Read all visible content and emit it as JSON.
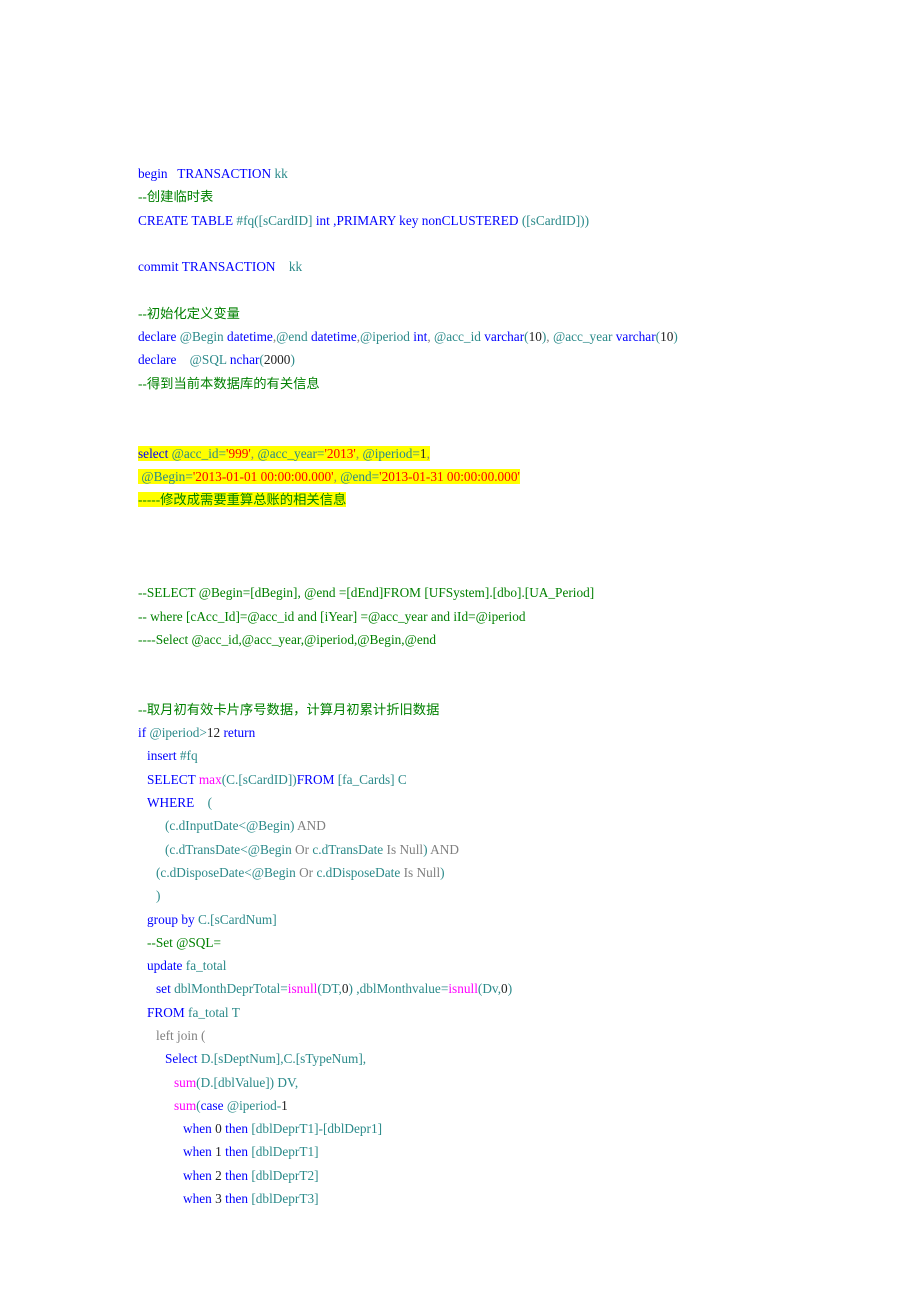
{
  "document": {
    "kind": "sql-script",
    "page_background": "#ffffff",
    "colors": {
      "keyword": "#0000ff",
      "comment": "#008000",
      "function": "#ff00ff",
      "identifier": "#2b8a8a",
      "operator": "#808080",
      "number": "#222222",
      "string": "#ff0000",
      "highlight": "#ffff00"
    }
  },
  "code": {
    "lines": [
      {
        "id": "line-1",
        "indent": 0,
        "highlight": false,
        "tokens": [
          {
            "t": "begin   ",
            "c": "kw"
          },
          {
            "t": "TRANSACTION ",
            "c": "kw"
          },
          {
            "t": "kk",
            "c": "id"
          }
        ]
      },
      {
        "id": "line-2",
        "indent": 0,
        "highlight": false,
        "tokens": [
          {
            "t": "--创建临时表",
            "c": "cmt"
          }
        ]
      },
      {
        "id": "line-3",
        "indent": 0,
        "highlight": false,
        "tokens": [
          {
            "t": "CREATE TABLE ",
            "c": "kw"
          },
          {
            "t": "#fq([sCardID] ",
            "c": "id"
          },
          {
            "t": "int ,PRIMARY key nonCLUSTERED ",
            "c": "kw"
          },
          {
            "t": "([sCardID]))",
            "c": "id"
          }
        ]
      },
      {
        "id": "line-4",
        "indent": 0,
        "highlight": false,
        "tokens": []
      },
      {
        "id": "line-5",
        "indent": 0,
        "highlight": false,
        "tokens": [
          {
            "t": "commit TRANSACTION    ",
            "c": "kw"
          },
          {
            "t": "kk",
            "c": "id"
          }
        ]
      },
      {
        "id": "line-6",
        "indent": 0,
        "highlight": false,
        "tokens": []
      },
      {
        "id": "line-7",
        "indent": 0,
        "highlight": false,
        "tokens": [
          {
            "t": "--初始化定义变量",
            "c": "cmt"
          }
        ]
      },
      {
        "id": "line-8",
        "indent": 0,
        "highlight": false,
        "tokens": [
          {
            "t": "declare ",
            "c": "kw"
          },
          {
            "t": "@Begin ",
            "c": "id"
          },
          {
            "t": "datetime",
            "c": "kw"
          },
          {
            "t": ",",
            "c": "op"
          },
          {
            "t": "@end ",
            "c": "id"
          },
          {
            "t": "datetime",
            "c": "kw"
          },
          {
            "t": ",",
            "c": "op"
          },
          {
            "t": "@iperiod ",
            "c": "id"
          },
          {
            "t": "int",
            "c": "kw"
          },
          {
            "t": ", ",
            "c": "op"
          },
          {
            "t": "@acc_id ",
            "c": "id"
          },
          {
            "t": "varchar",
            "c": "kw"
          },
          {
            "t": "(",
            "c": "id"
          },
          {
            "t": "10",
            "c": "num"
          },
          {
            "t": ")",
            "c": "id"
          },
          {
            "t": ", ",
            "c": "op"
          },
          {
            "t": "@acc_year ",
            "c": "id"
          },
          {
            "t": "varchar",
            "c": "kw"
          },
          {
            "t": "(",
            "c": "id"
          },
          {
            "t": "10",
            "c": "num"
          },
          {
            "t": ")",
            "c": "id"
          }
        ]
      },
      {
        "id": "line-9",
        "indent": 0,
        "highlight": false,
        "tokens": [
          {
            "t": "declare ",
            "c": "kw"
          },
          {
            "t": "   @SQL ",
            "c": "id"
          },
          {
            "t": "nchar",
            "c": "kw"
          },
          {
            "t": "(",
            "c": "id"
          },
          {
            "t": "2000",
            "c": "num"
          },
          {
            "t": ")",
            "c": "id"
          }
        ]
      },
      {
        "id": "line-10",
        "indent": 0,
        "highlight": false,
        "tokens": [
          {
            "t": "--得到当前本数据库的有关信息",
            "c": "cmt"
          }
        ]
      },
      {
        "id": "line-11",
        "indent": 0,
        "highlight": false,
        "tokens": []
      },
      {
        "id": "line-12",
        "indent": 0,
        "highlight": false,
        "tokens": []
      },
      {
        "id": "line-13",
        "indent": 0,
        "highlight": true,
        "tokens": [
          {
            "t": "select ",
            "c": "kw"
          },
          {
            "t": "@acc_id=",
            "c": "id"
          },
          {
            "t": "'999'",
            "c": "str"
          },
          {
            "t": ", ",
            "c": "op"
          },
          {
            "t": "@acc_year=",
            "c": "id"
          },
          {
            "t": "'2013'",
            "c": "str"
          },
          {
            "t": ", ",
            "c": "op"
          },
          {
            "t": "@iperiod=",
            "c": "id"
          },
          {
            "t": "1",
            "c": "num"
          },
          {
            "t": ",",
            "c": "op"
          }
        ]
      },
      {
        "id": "line-14",
        "indent": 0,
        "highlight": true,
        "tokens": [
          {
            "t": " @Begin=",
            "c": "id"
          },
          {
            "t": "'2013-01-01 00:00:00.000'",
            "c": "str"
          },
          {
            "t": ", ",
            "c": "op"
          },
          {
            "t": "@end=",
            "c": "id"
          },
          {
            "t": "'2013-01-31 00:00:00.000'",
            "c": "str"
          }
        ]
      },
      {
        "id": "line-15",
        "indent": 0,
        "highlight": true,
        "tokens": [
          {
            "t": "-----修改成需要重算总账的相关信息",
            "c": "cmt"
          }
        ]
      },
      {
        "id": "line-16",
        "indent": 0,
        "highlight": false,
        "tokens": []
      },
      {
        "id": "line-17",
        "indent": 0,
        "highlight": false,
        "tokens": []
      },
      {
        "id": "line-18",
        "indent": 0,
        "highlight": false,
        "tokens": []
      },
      {
        "id": "line-19",
        "indent": 0,
        "highlight": false,
        "tokens": [
          {
            "t": "--SELECT @Begin=[dBegin], @end =[dEnd]FROM [UFSystem].[dbo].[UA_Period]",
            "c": "cmt"
          }
        ]
      },
      {
        "id": "line-20",
        "indent": 0,
        "highlight": false,
        "tokens": [
          {
            "t": "-- where [cAcc_Id]=@acc_id and [iYear] =@acc_year and iId=@iperiod",
            "c": "cmt"
          }
        ]
      },
      {
        "id": "line-21",
        "indent": 0,
        "highlight": false,
        "tokens": [
          {
            "t": "----Select @acc_id,@acc_year,@iperiod,@Begin,@end",
            "c": "cmt"
          }
        ]
      },
      {
        "id": "line-22",
        "indent": 0,
        "highlight": false,
        "tokens": []
      },
      {
        "id": "line-23",
        "indent": 0,
        "highlight": false,
        "tokens": []
      },
      {
        "id": "line-24",
        "indent": 0,
        "highlight": false,
        "tokens": [
          {
            "t": "--取月初有效卡片序号数据，计算月初累计折旧数据",
            "c": "cmt"
          }
        ]
      },
      {
        "id": "line-25",
        "indent": 0,
        "highlight": false,
        "tokens": [
          {
            "t": "if ",
            "c": "kw"
          },
          {
            "t": "@iperiod>",
            "c": "id"
          },
          {
            "t": "12 ",
            "c": "num"
          },
          {
            "t": "return",
            "c": "kw"
          }
        ]
      },
      {
        "id": "line-26",
        "indent": 1,
        "highlight": false,
        "tokens": [
          {
            "t": "insert ",
            "c": "kw"
          },
          {
            "t": "#fq",
            "c": "id"
          }
        ]
      },
      {
        "id": "line-27",
        "indent": 1,
        "highlight": false,
        "tokens": [
          {
            "t": "SELECT ",
            "c": "kw"
          },
          {
            "t": "max",
            "c": "fn"
          },
          {
            "t": "(C.[sCardID])",
            "c": "id"
          },
          {
            "t": "FROM ",
            "c": "kw"
          },
          {
            "t": "[fa_Cards] C",
            "c": "id"
          }
        ]
      },
      {
        "id": "line-28",
        "indent": 1,
        "highlight": false,
        "tokens": [
          {
            "t": "WHERE ",
            "c": "kw"
          },
          {
            "t": "   (",
            "c": "id"
          }
        ]
      },
      {
        "id": "line-29",
        "indent": 3,
        "highlight": false,
        "tokens": [
          {
            "t": "(c.dInputDate<@Begin) ",
            "c": "id"
          },
          {
            "t": "AND",
            "c": "op"
          }
        ]
      },
      {
        "id": "line-30",
        "indent": 3,
        "highlight": false,
        "tokens": [
          {
            "t": "(c.dTransDate<@Begin ",
            "c": "id"
          },
          {
            "t": "Or ",
            "c": "op"
          },
          {
            "t": "c.dTransDate ",
            "c": "id"
          },
          {
            "t": "Is Null",
            "c": "op"
          },
          {
            "t": ") ",
            "c": "id"
          },
          {
            "t": "AND",
            "c": "op"
          }
        ]
      },
      {
        "id": "line-31",
        "indent": 2,
        "highlight": false,
        "tokens": [
          {
            "t": "(c.dDisposeDate<@Begin ",
            "c": "id"
          },
          {
            "t": "Or ",
            "c": "op"
          },
          {
            "t": "c.dDisposeDate ",
            "c": "id"
          },
          {
            "t": "Is Null",
            "c": "op"
          },
          {
            "t": ")",
            "c": "id"
          }
        ]
      },
      {
        "id": "line-32",
        "indent": 2,
        "highlight": false,
        "tokens": [
          {
            "t": ")",
            "c": "id"
          }
        ]
      },
      {
        "id": "line-33",
        "indent": 1,
        "highlight": false,
        "tokens": [
          {
            "t": "group by ",
            "c": "kw"
          },
          {
            "t": "C.[sCardNum]",
            "c": "id"
          }
        ]
      },
      {
        "id": "line-34",
        "indent": 1,
        "highlight": false,
        "tokens": [
          {
            "t": "--Set @SQL=",
            "c": "cmt"
          }
        ]
      },
      {
        "id": "line-35",
        "indent": 1,
        "highlight": false,
        "tokens": [
          {
            "t": "update ",
            "c": "kw"
          },
          {
            "t": "fa_total",
            "c": "id"
          }
        ]
      },
      {
        "id": "line-36",
        "indent": 2,
        "highlight": false,
        "tokens": [
          {
            "t": "set ",
            "c": "kw"
          },
          {
            "t": "dblMonthDeprTotal=",
            "c": "id"
          },
          {
            "t": "isnull",
            "c": "fn"
          },
          {
            "t": "(DT,",
            "c": "id"
          },
          {
            "t": "0",
            "c": "num"
          },
          {
            "t": ") ,dblMonthvalue=",
            "c": "id"
          },
          {
            "t": "isnull",
            "c": "fn"
          },
          {
            "t": "(Dv,",
            "c": "id"
          },
          {
            "t": "0",
            "c": "num"
          },
          {
            "t": ")",
            "c": "id"
          }
        ]
      },
      {
        "id": "line-37",
        "indent": 1,
        "highlight": false,
        "tokens": [
          {
            "t": "FROM ",
            "c": "kw"
          },
          {
            "t": "fa_total T",
            "c": "id"
          }
        ]
      },
      {
        "id": "line-38",
        "indent": 2,
        "highlight": false,
        "tokens": [
          {
            "t": "left join (",
            "c": "op"
          }
        ]
      },
      {
        "id": "line-39",
        "indent": 3,
        "highlight": false,
        "tokens": [
          {
            "t": "Select ",
            "c": "kw"
          },
          {
            "t": "D.[sDeptNum],C.[sTypeNum],",
            "c": "id"
          }
        ]
      },
      {
        "id": "line-40",
        "indent": 4,
        "highlight": false,
        "tokens": [
          {
            "t": "sum",
            "c": "fn"
          },
          {
            "t": "(D.[dblValue]) DV,",
            "c": "id"
          }
        ]
      },
      {
        "id": "line-41",
        "indent": 4,
        "highlight": false,
        "tokens": [
          {
            "t": "sum",
            "c": "fn"
          },
          {
            "t": "(",
            "c": "id"
          },
          {
            "t": "case ",
            "c": "kw"
          },
          {
            "t": "@iperiod-",
            "c": "id"
          },
          {
            "t": "1",
            "c": "num"
          }
        ]
      },
      {
        "id": "line-42",
        "indent": 5,
        "highlight": false,
        "tokens": [
          {
            "t": "when ",
            "c": "kw"
          },
          {
            "t": "0 ",
            "c": "num"
          },
          {
            "t": "then ",
            "c": "kw"
          },
          {
            "t": "[dblDeprT1]-[dblDepr1]",
            "c": "id"
          }
        ]
      },
      {
        "id": "line-43",
        "indent": 5,
        "highlight": false,
        "tokens": [
          {
            "t": "when ",
            "c": "kw"
          },
          {
            "t": "1 ",
            "c": "num"
          },
          {
            "t": "then ",
            "c": "kw"
          },
          {
            "t": "[dblDeprT1]",
            "c": "id"
          }
        ]
      },
      {
        "id": "line-44",
        "indent": 5,
        "highlight": false,
        "tokens": [
          {
            "t": "when ",
            "c": "kw"
          },
          {
            "t": "2 ",
            "c": "num"
          },
          {
            "t": "then ",
            "c": "kw"
          },
          {
            "t": "[dblDeprT2]",
            "c": "id"
          }
        ]
      },
      {
        "id": "line-45",
        "indent": 5,
        "highlight": false,
        "tokens": [
          {
            "t": "when ",
            "c": "kw"
          },
          {
            "t": "3 ",
            "c": "num"
          },
          {
            "t": "then ",
            "c": "kw"
          },
          {
            "t": "[dblDeprT3]",
            "c": "id"
          }
        ]
      }
    ]
  }
}
